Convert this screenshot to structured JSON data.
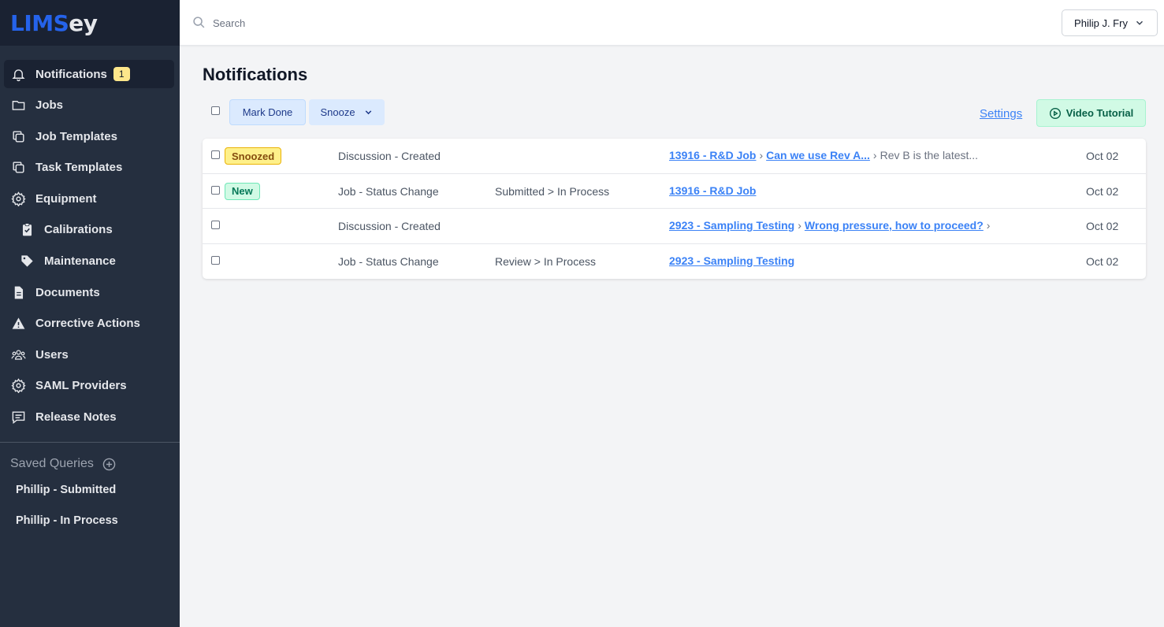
{
  "logo": {
    "part1": "LIMS",
    "part2": "ey"
  },
  "search": {
    "placeholder": "Search"
  },
  "user": {
    "name": "Philip J. Fry"
  },
  "sidebar": {
    "items": [
      {
        "label": "Notifications",
        "icon": "bell-icon",
        "badge": "1",
        "active": true
      },
      {
        "label": "Jobs",
        "icon": "folder-icon"
      },
      {
        "label": "Job Templates",
        "icon": "copy-icon"
      },
      {
        "label": "Task Templates",
        "icon": "copy-icon"
      },
      {
        "label": "Equipment",
        "icon": "gear-icon"
      },
      {
        "label": "Calibrations",
        "icon": "clipboard-check-icon",
        "sub": true
      },
      {
        "label": "Maintenance",
        "icon": "tag-icon",
        "sub": true
      },
      {
        "label": "Documents",
        "icon": "document-icon"
      },
      {
        "label": "Corrective Actions",
        "icon": "warning-icon"
      },
      {
        "label": "Users",
        "icon": "users-icon"
      },
      {
        "label": "SAML Providers",
        "icon": "gear-icon"
      },
      {
        "label": "Release Notes",
        "icon": "chat-icon"
      }
    ],
    "saved_queries_title": "Saved Queries",
    "saved_queries": [
      "Phillip - Submitted",
      "Phillip - In Process"
    ]
  },
  "main": {
    "title": "Notifications",
    "mark_done_label": "Mark Done",
    "snooze_label": "Snooze",
    "settings_label": "Settings",
    "video_tutorial_label": "Video Tutorial",
    "rows": [
      {
        "badge": "Snoozed",
        "type": "Discussion - Created",
        "change": "",
        "link1": "13916 - R&D Job",
        "link2": "Can we use Rev A...",
        "trail": "Rev B is the latest...",
        "date": "Oct 02"
      },
      {
        "badge": "New",
        "type": "Job - Status Change",
        "change": "Submitted > In Process",
        "link1": "13916 - R&D Job",
        "link2": "",
        "trail": "",
        "date": "Oct 02"
      },
      {
        "badge": "",
        "type": "Discussion - Created",
        "change": "",
        "link1": "2923 - Sampling Testing",
        "link2": "Wrong pressure, how to proceed?",
        "trail": "",
        "date": "Oct 02"
      },
      {
        "badge": "",
        "type": "Job - Status Change",
        "change": "Review > In Process",
        "link1": "2923 - Sampling Testing",
        "link2": "",
        "trail": "",
        "date": "Oct 02"
      }
    ]
  },
  "colors": {
    "sidebar_bg": "#252f3f",
    "brand_blue": "#2563eb",
    "link_blue": "#3b82f6",
    "snoozed_bg": "#fef08a",
    "new_bg": "#d1fae5"
  }
}
